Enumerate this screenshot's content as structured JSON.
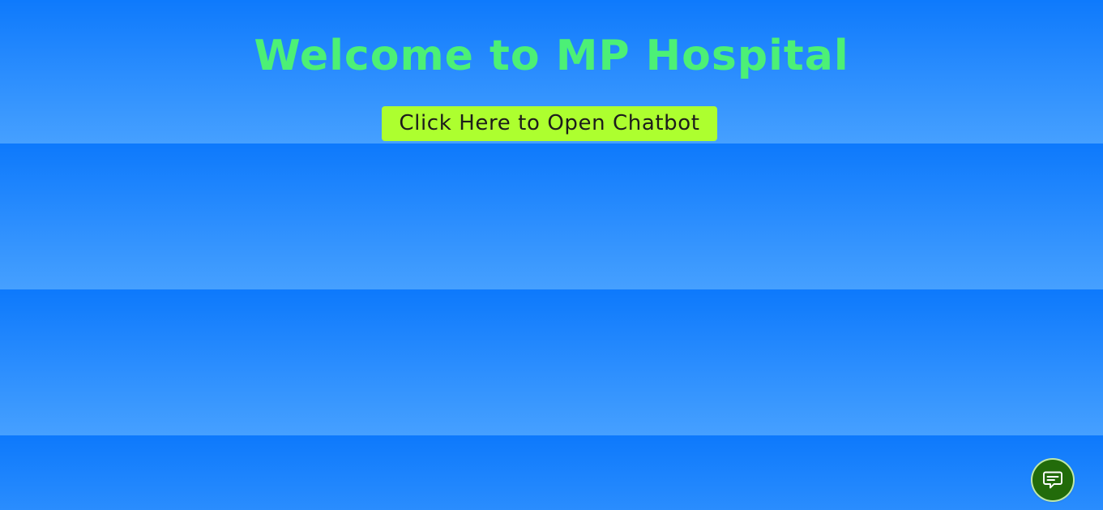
{
  "page": {
    "title": "Welcome to MP Hospital"
  },
  "hero": {
    "button_label": "Click Here to Open Chatbot"
  },
  "chat_launcher": {
    "icon": "chat-bubble-icon"
  },
  "colors": {
    "title": "#4cf076",
    "button_background": "#adff2f",
    "background_top": "#0d79fc",
    "background_bottom": "#46a0ff",
    "launcher_background": "#226b0a"
  }
}
